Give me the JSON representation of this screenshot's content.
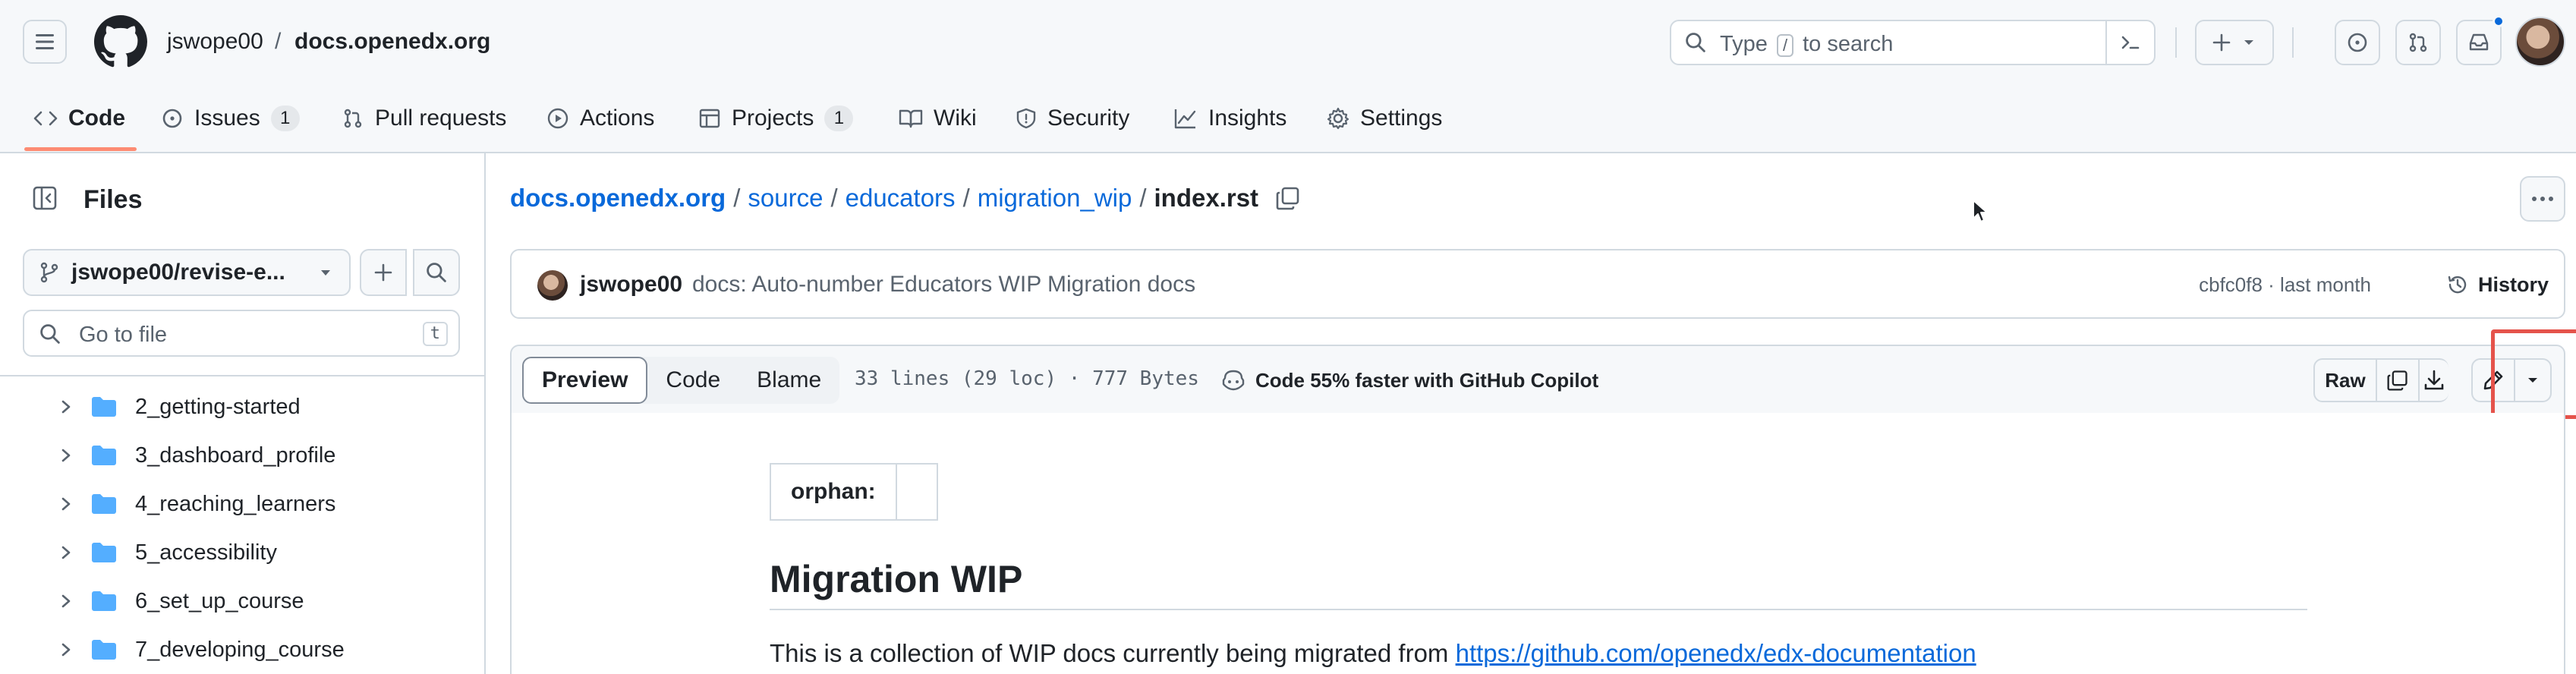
{
  "header": {
    "owner": "jswope00",
    "separator": "/",
    "repo": "docs.openedx.org",
    "search": {
      "prefix": "Type",
      "key": "/",
      "suffix": "to search"
    }
  },
  "repo_nav": {
    "tabs": [
      {
        "label": "Code",
        "icon": "code-icon",
        "active": true
      },
      {
        "label": "Issues",
        "icon": "issue-opened-icon",
        "count": "1"
      },
      {
        "label": "Pull requests",
        "icon": "git-pull-request-icon"
      },
      {
        "label": "Actions",
        "icon": "play-icon"
      },
      {
        "label": "Projects",
        "icon": "table-icon",
        "count": "1"
      },
      {
        "label": "Wiki",
        "icon": "book-icon"
      },
      {
        "label": "Security",
        "icon": "shield-icon"
      },
      {
        "label": "Insights",
        "icon": "graph-icon"
      },
      {
        "label": "Settings",
        "icon": "gear-icon"
      }
    ]
  },
  "sidebar": {
    "title": "Files",
    "branch": "jswope00/revise-e...",
    "go_to_file": {
      "placeholder": "Go to file",
      "shortcut": "t"
    },
    "tree": [
      "2_getting-started",
      "3_dashboard_profile",
      "4_reaching_learners",
      "5_accessibility",
      "6_set_up_course",
      "7_developing_course"
    ]
  },
  "breadcrumb": {
    "root": "docs.openedx.org",
    "parts": [
      "source",
      "educators",
      "migration_wip"
    ],
    "current": "index.rst",
    "sep": "/"
  },
  "commit": {
    "author": "jswope00",
    "message": "docs: Auto-number Educators WIP Migration docs",
    "meta": "cbfc0f8 · last month",
    "history_label": "History"
  },
  "file_toolbar": {
    "views": [
      "Preview",
      "Code",
      "Blame"
    ],
    "active_view": "Preview",
    "info": "33 lines (29 loc) · 777 Bytes",
    "copilot": "Code 55% faster with GitHub Copilot",
    "raw_label": "Raw"
  },
  "content": {
    "field_key": "orphan:",
    "field_value": "",
    "heading": "Migration WIP",
    "paragraph_text": "This is a collection of WIP docs currently being migrated from",
    "paragraph_link": "https://github.com/openedx/edx-documentation"
  },
  "colors": {
    "link": "#0969da",
    "tab_underline": "#fd8c73",
    "highlight_box": "#e5534b",
    "folder": "#54aeff"
  }
}
